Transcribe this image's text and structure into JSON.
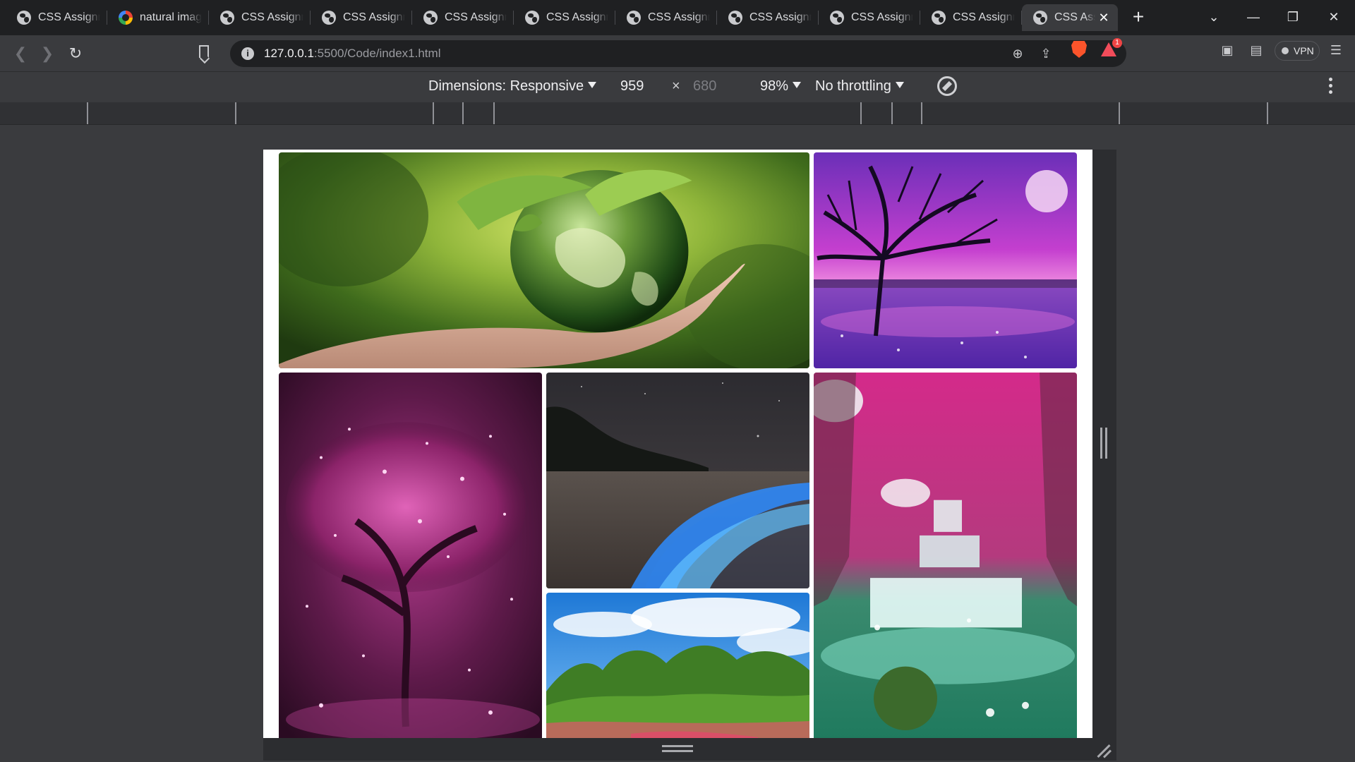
{
  "browser": {
    "tabs": [
      {
        "title": "CSS Assignm",
        "favicon": "globe-icon",
        "active": false
      },
      {
        "title": "natural image",
        "favicon": "google-icon",
        "active": false
      },
      {
        "title": "CSS Assignm",
        "favicon": "globe-icon",
        "active": false
      },
      {
        "title": "CSS Assignm",
        "favicon": "globe-icon",
        "active": false
      },
      {
        "title": "CSS Assignm",
        "favicon": "globe-icon",
        "active": false
      },
      {
        "title": "CSS Assignm",
        "favicon": "globe-icon",
        "active": false
      },
      {
        "title": "CSS Assignm",
        "favicon": "globe-icon",
        "active": false
      },
      {
        "title": "CSS Assignm",
        "favicon": "globe-icon",
        "active": false
      },
      {
        "title": "CSS Assignm",
        "favicon": "globe-icon",
        "active": false
      },
      {
        "title": "CSS Assignm",
        "favicon": "globe-icon",
        "active": false
      },
      {
        "title": "CSS Assi",
        "favicon": "globe-icon",
        "active": true
      }
    ],
    "new_tab": "+",
    "address": {
      "host": "127.0.0.1",
      "rest": ":5500/Code/index1.html"
    },
    "notification_count": "1",
    "vpn_label": "VPN"
  },
  "device_toolbar": {
    "dimensions_label": "Dimensions: Responsive",
    "width": "959",
    "times": "×",
    "height": "680",
    "zoom": "98%",
    "throttling": "No throttling"
  },
  "gallery": {
    "images": [
      {
        "name": "earth-in-hand",
        "subject": "green earth globe with leaves held in a hand"
      },
      {
        "name": "purple-tree-lake",
        "subject": "silhouetted tree over a purple lake under a moon"
      },
      {
        "name": "pink-glowing-tree",
        "subject": "glowing pink tree with sparkles"
      },
      {
        "name": "bioluminescent-beach",
        "subject": "blue glowing waves on a night beach"
      },
      {
        "name": "jungle-river",
        "subject": "green trees over a red river under blue sky"
      },
      {
        "name": "pink-forest-waterfall",
        "subject": "cascading waterfalls through a pink forest"
      }
    ]
  },
  "colors": {
    "chrome_dark": "#1f2022",
    "chrome_mid": "#3a3b3e",
    "brave_orange": "#fb542b",
    "alert_red": "#ef4444"
  }
}
